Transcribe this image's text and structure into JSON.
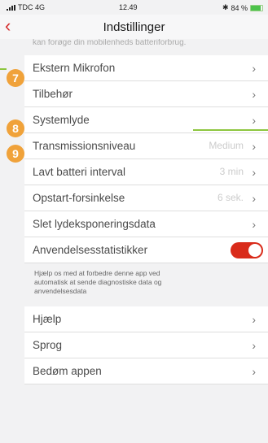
{
  "status": {
    "carrier": "TDC 4G",
    "time": "12.49",
    "battery": "84 %",
    "battery_level": 0.84
  },
  "nav": {
    "back_icon": "chevron-left",
    "title": "Indstillinger"
  },
  "header_cut": "kan forøge din mobilenheds batteriforbrug.",
  "rows": [
    {
      "label": "Ekstern Mikrofon"
    },
    {
      "label": "Tilbehør"
    },
    {
      "label": "Systemlyde"
    },
    {
      "label": "Transmissionsniveau",
      "value": "Medium"
    },
    {
      "label": "Lavt batteri interval",
      "value": "3 min"
    },
    {
      "label": "Opstart-forsinkelse",
      "value": "6 sek."
    },
    {
      "label": "Slet lydeksponeringsdata"
    }
  ],
  "toggle_row": {
    "label": "Anvendelsesstatistikker",
    "enabled": true,
    "accent": "#d92b1a"
  },
  "toggle_desc": "Hjælp os med at forbedre denne app ved automatisk at sende diagnostiske data og anvendelsesdata",
  "bottom_rows": [
    {
      "label": "Hjælp"
    },
    {
      "label": "Sprog"
    },
    {
      "label": "Bedøm appen"
    }
  ],
  "callouts": [
    "7",
    "8",
    "9"
  ],
  "colors": {
    "badge": "#f0a23a",
    "pointer": "#8dc63f",
    "brand_red": "#d42b2b"
  }
}
